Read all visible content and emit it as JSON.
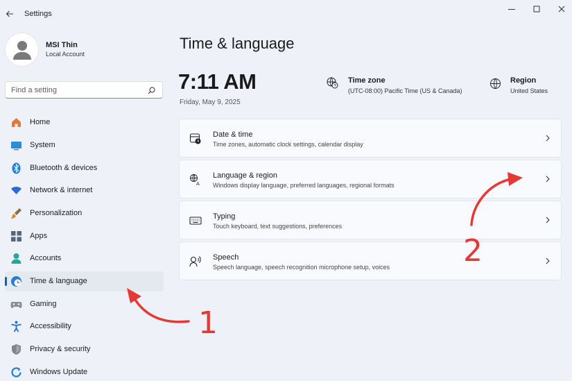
{
  "window": {
    "title": "Settings",
    "controls": [
      "minimize",
      "maximize",
      "close"
    ]
  },
  "account": {
    "name": "MSI Thin",
    "type": "Local Account"
  },
  "search": {
    "placeholder": "Find a setting",
    "value": ""
  },
  "sidebar": {
    "items": [
      {
        "label": "Home",
        "icon": "home-icon",
        "color": "#e1783c"
      },
      {
        "label": "System",
        "icon": "system-icon",
        "color": "#2b8fd6"
      },
      {
        "label": "Bluetooth & devices",
        "icon": "bluetooth-icon",
        "color": "#1f7fd4"
      },
      {
        "label": "Network & internet",
        "icon": "wifi-icon",
        "color": "#2b6cd0"
      },
      {
        "label": "Personalization",
        "icon": "brush-icon",
        "color": "#d88c2c"
      },
      {
        "label": "Apps",
        "icon": "apps-icon",
        "color": "#5a6577"
      },
      {
        "label": "Accounts",
        "icon": "person-icon",
        "color": "#28a59a"
      },
      {
        "label": "Time & language",
        "icon": "globe-clock-icon",
        "color": "#2c7ad6",
        "active": true
      },
      {
        "label": "Gaming",
        "icon": "gamepad-icon",
        "color": "#8a8f98"
      },
      {
        "label": "Accessibility",
        "icon": "accessibility-icon",
        "color": "#1f6fd4"
      },
      {
        "label": "Privacy & security",
        "icon": "shield-icon",
        "color": "#7d8591"
      },
      {
        "label": "Windows Update",
        "icon": "update-icon",
        "color": "#1f7fd4"
      }
    ]
  },
  "main": {
    "title": "Time & language",
    "time": "7:11 AM",
    "date": "Friday, May 9, 2025",
    "timezone": {
      "title": "Time zone",
      "value": "(UTC-08:00) Pacific Time (US & Canada)"
    },
    "region": {
      "title": "Region",
      "value": "United States"
    },
    "cards": [
      {
        "title": "Date & time",
        "desc": "Time zones, automatic clock settings, calendar display",
        "icon": "calendar-clock-icon"
      },
      {
        "title": "Language & region",
        "desc": "Windows display language, preferred languages, regional formats",
        "icon": "language-icon"
      },
      {
        "title": "Typing",
        "desc": "Touch keyboard, text suggestions, preferences",
        "icon": "keyboard-icon"
      },
      {
        "title": "Speech",
        "desc": "Speech language, speech recognition microphone setup, voices",
        "icon": "speech-icon"
      }
    ]
  },
  "annotations": {
    "step1": "1",
    "step2": "2",
    "color": "#e53935"
  }
}
